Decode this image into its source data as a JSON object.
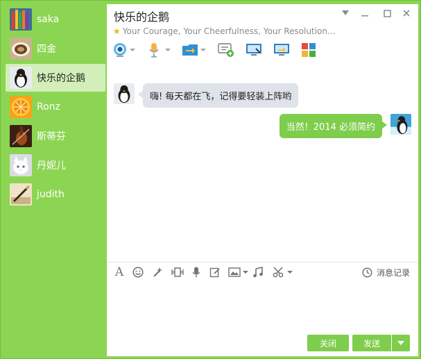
{
  "window": {
    "title": "快乐的企鹅",
    "signature": "Your Courage, Your Cheerfulness, Your Resolution..."
  },
  "contacts": [
    {
      "name": "saka",
      "avatar": "pencils-avatar-icon"
    },
    {
      "name": "四金",
      "avatar": "espresso-avatar-icon"
    },
    {
      "name": "快乐的企鹅",
      "avatar": "penguin-avatar-icon",
      "active": true
    },
    {
      "name": "Ronz",
      "avatar": "orange-slice-avatar-icon"
    },
    {
      "name": "斯蒂芬",
      "avatar": "violin-avatar-icon"
    },
    {
      "name": "丹妮儿",
      "avatar": "kitten-avatar-icon"
    },
    {
      "name": "judith",
      "avatar": "writing-pen-avatar-icon"
    }
  ],
  "messages": [
    {
      "direction": "incoming",
      "text": "嗨! 每天都在飞，记得要轻装上阵哟"
    },
    {
      "direction": "outgoing",
      "text": "当然！2014 必须简约"
    }
  ],
  "toolbar": {
    "history_label": "消息记录"
  },
  "buttons": {
    "close_label": "关闭",
    "send_label": "发送"
  },
  "colors": {
    "accent_green": "#7fcd4c",
    "sidebar_green": "#8bd552",
    "active_contact": "#d2efb9",
    "incoming_bubble": "#dde3e9"
  }
}
